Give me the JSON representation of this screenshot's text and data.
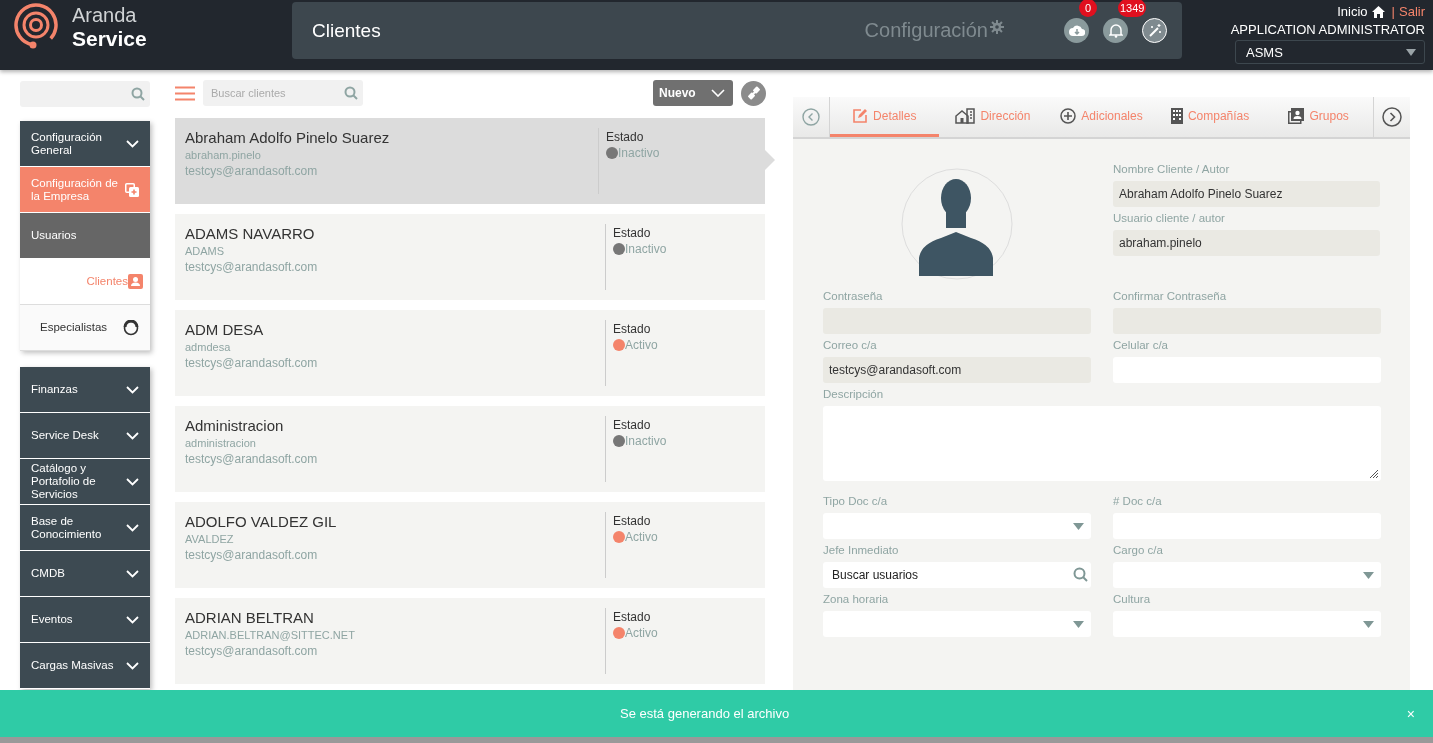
{
  "header": {
    "logo_top": "Aranda",
    "logo_bottom": "Service",
    "breadcrumb": "Clientes",
    "module": "Configuración",
    "badges": [
      {
        "count": "0"
      },
      {
        "count": "1349"
      }
    ],
    "home_link": "Inicio",
    "separator": "|",
    "logout_link": "Salir",
    "user": "APPLICATION ADMINISTRATOR",
    "project": "ASMS"
  },
  "sidebar": {
    "menu_top": [
      {
        "label": "Configuración General",
        "kind": "group",
        "selected": false
      },
      {
        "label": "Configuración de la Empresa",
        "kind": "section",
        "selected": false
      },
      {
        "label": "Usuarios",
        "kind": "subsection",
        "selected": false
      },
      {
        "label": "Clientes",
        "kind": "link",
        "selected": true
      },
      {
        "label": "Especialistas",
        "kind": "link",
        "selected": false
      }
    ],
    "menu_bottom": [
      {
        "label": "Finanzas",
        "kind": "group",
        "selected": false
      },
      {
        "label": "Service Desk",
        "kind": "group",
        "selected": false
      },
      {
        "label": "Catálogo y Portafolio de Servicios",
        "kind": "group",
        "selected": false
      },
      {
        "label": "Base de Conocimiento",
        "kind": "group",
        "selected": false
      },
      {
        "label": "CMDB",
        "kind": "group",
        "selected": false
      },
      {
        "label": "Eventos",
        "kind": "group",
        "selected": false
      },
      {
        "label": "Cargas Masivas",
        "kind": "group",
        "selected": false
      }
    ]
  },
  "list": {
    "search": {
      "placeholder": "Buscar clientes"
    },
    "new_button": "Nuevo",
    "clients": [
      {
        "name": "Abraham Adolfo Pinelo Suarez",
        "user": "abraham.pinelo",
        "email": "testcys@arandasoft.com",
        "status_label": "Estado",
        "status": "Inactivo",
        "color": "#777777",
        "selected": true
      },
      {
        "name": "ADAMS NAVARRO",
        "user": "ADAMS",
        "email": "testcys@arandasoft.com",
        "status_label": "Estado",
        "status": "Inactivo",
        "color": "#777777",
        "selected": false
      },
      {
        "name": "ADM DESA",
        "user": "admdesa",
        "email": "testcys@arandasoft.com",
        "status_label": "Estado",
        "status": "Activo",
        "color": "#f4846b",
        "selected": false
      },
      {
        "name": "Administracion",
        "user": "administracion",
        "email": "testcys@arandasoft.com",
        "status_label": "Estado",
        "status": "Inactivo",
        "color": "#777777",
        "selected": false
      },
      {
        "name": "ADOLFO VALDEZ GIL",
        "user": "AVALDEZ",
        "email": "testcys@arandasoft.com",
        "status_label": "Estado",
        "status": "Activo",
        "color": "#f4846b",
        "selected": false
      },
      {
        "name": "ADRIAN BELTRAN",
        "user": "ADRIAN.BELTRAN@SITTEC.NET",
        "email": "testcys@arandasoft.com",
        "status_label": "Estado",
        "status": "Activo",
        "color": "#f4846b",
        "selected": false
      }
    ]
  },
  "detail": {
    "tabs": [
      {
        "label": "Detalles",
        "selected": true
      },
      {
        "label": "Dirección",
        "selected": false
      },
      {
        "label": "Adicionales",
        "selected": false
      },
      {
        "label": "Compañías",
        "selected": false
      },
      {
        "label": "Grupos",
        "selected": false
      }
    ],
    "top_fields": [
      {
        "label": "Nombre Cliente / Autor",
        "value": "Abraham Adolfo Pinelo Suarez",
        "disabled": true
      },
      {
        "label": "Usuario cliente / autor",
        "value": "abraham.pinelo",
        "disabled": true
      }
    ],
    "fields": [
      {
        "label": "Contraseña",
        "kind": "text",
        "disabled": true
      },
      {
        "label": "Confirmar Contraseña",
        "kind": "text",
        "disabled": true
      },
      {
        "label": "Correo c/a",
        "value": "testcys@arandasoft.com",
        "kind": "text",
        "disabled": true
      },
      {
        "label": "Celular c/a",
        "kind": "text",
        "disabled": false
      },
      {
        "label": "Descripción",
        "kind": "textarea",
        "disabled": false
      },
      {
        "label": "Tipo Doc c/a",
        "kind": "select",
        "disabled": false
      },
      {
        "label": "# Doc c/a",
        "kind": "text",
        "disabled": false
      },
      {
        "label": "Jefe Inmediato",
        "placeholder": "Buscar usuarios",
        "kind": "search",
        "disabled": false
      },
      {
        "label": "Cargo c/a",
        "kind": "select",
        "disabled": false
      },
      {
        "label": "Zona horaria",
        "kind": "select",
        "disabled": false
      },
      {
        "label": "Cultura",
        "kind": "select",
        "disabled": false
      }
    ]
  },
  "toast": {
    "message": "Se está generando el archivo",
    "close": "×"
  }
}
